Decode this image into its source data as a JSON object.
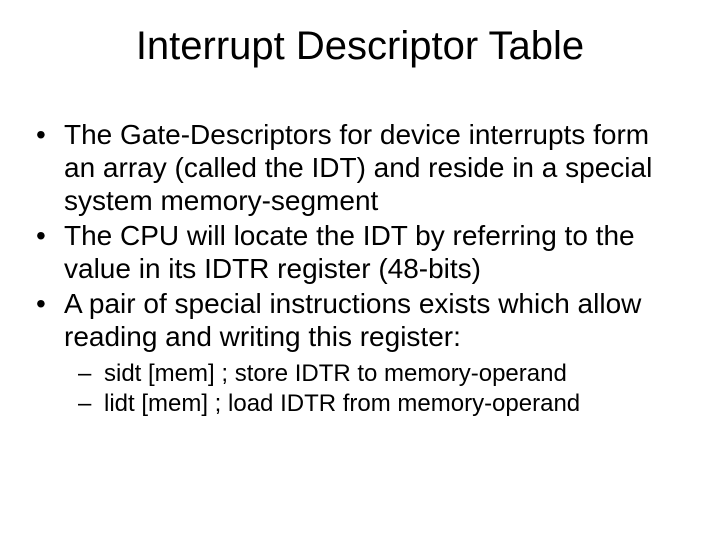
{
  "title": "Interrupt Descriptor Table",
  "bullets": [
    "The Gate-Descriptors for device interrupts form an array (called the IDT) and reside in a special system memory-segment",
    "The CPU will locate the IDT by referring to the value in its IDTR register (48-bits)",
    "A pair of special instructions exists which allow reading and writing this register:"
  ],
  "subbullets": [
    "sidt  [mem]   ; store IDTR to memory-operand",
    "lidt  [mem]  ; load IDTR from memory-operand"
  ]
}
